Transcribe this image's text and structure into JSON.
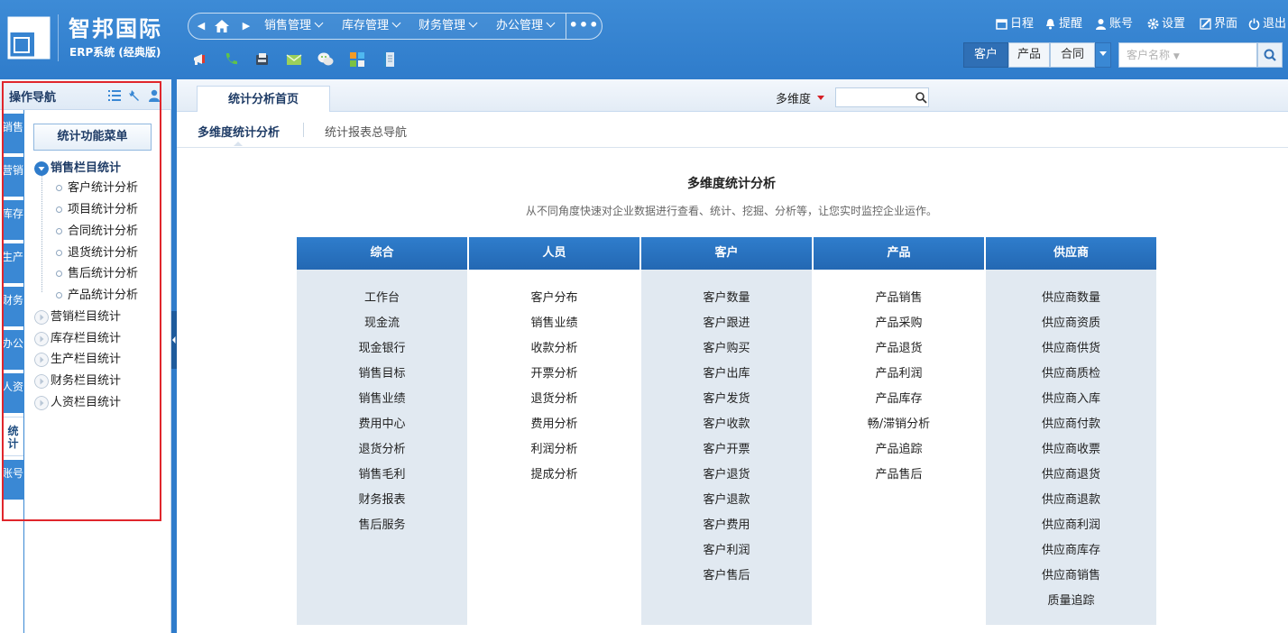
{
  "app": {
    "title": "智邦国际",
    "subtitle": "ERP系统 (经典版)"
  },
  "topnav": {
    "menus": [
      "销售管理",
      "库存管理",
      "财务管理",
      "办公管理"
    ],
    "more": "•••"
  },
  "quicktools": [
    "megaphone-icon",
    "phone-icon",
    "fax-icon",
    "mail-icon",
    "wechat-icon",
    "apps-icon",
    "document-icon"
  ],
  "usertools": {
    "schedule": "日程",
    "reminder": "提醒",
    "account": "账号",
    "settings": "设置",
    "interface": "界面",
    "logout": "退出"
  },
  "search": {
    "segments": [
      "客户",
      "产品",
      "合同"
    ],
    "active_segment": "客户",
    "placeholder": "客户名称"
  },
  "sidebar": {
    "title": "操作导航",
    "vtabs": [
      "销售",
      "营销",
      "库存",
      "生产",
      "财务",
      "办公",
      "人资",
      "统计",
      "账号"
    ],
    "active_vtab": "统计",
    "menu_button": "统计功能菜单",
    "tree": [
      {
        "label": "销售栏目统计",
        "expanded": true,
        "children": [
          "客户统计分析",
          "项目统计分析",
          "合同统计分析",
          "退货统计分析",
          "售后统计分析",
          "产品统计分析"
        ]
      },
      {
        "label": "营销栏目统计",
        "expanded": false
      },
      {
        "label": "库存栏目统计",
        "expanded": false
      },
      {
        "label": "生产栏目统计",
        "expanded": false
      },
      {
        "label": "财务栏目统计",
        "expanded": false
      },
      {
        "label": "人资栏目统计",
        "expanded": false
      }
    ]
  },
  "main": {
    "tab": "统计分析首页",
    "dimension_label": "多维度",
    "subtabs": [
      "多维度统计分析",
      "统计报表总导航"
    ],
    "title": "多维度统计分析",
    "subtitle": "从不同角度快速对企业数据进行查看、统计、挖掘、分析等，让您实时监控企业运作。",
    "columns": [
      {
        "header": "综合",
        "items": [
          "工作台",
          "现金流",
          "现金银行",
          "销售目标",
          "销售业绩",
          "费用中心",
          "退货分析",
          "销售毛利",
          "财务报表",
          "售后服务"
        ]
      },
      {
        "header": "人员",
        "items": [
          "客户分布",
          "销售业绩",
          "收款分析",
          "开票分析",
          "退货分析",
          "费用分析",
          "利润分析",
          "提成分析"
        ]
      },
      {
        "header": "客户",
        "items": [
          "客户数量",
          "客户跟进",
          "客户购买",
          "客户出库",
          "客户发货",
          "客户收款",
          "客户开票",
          "客户退货",
          "客户退款",
          "客户费用",
          "客户利润",
          "客户售后"
        ]
      },
      {
        "header": "产品",
        "items": [
          "产品销售",
          "产品采购",
          "产品退货",
          "产品利润",
          "产品库存",
          "畅/滞销分析",
          "产品追踪",
          "产品售后"
        ]
      },
      {
        "header": "供应商",
        "items": [
          "供应商数量",
          "供应商资质",
          "供应商供货",
          "供应商质检",
          "供应商入库",
          "供应商付款",
          "供应商收票",
          "供应商退货",
          "供应商退款",
          "供应商利润",
          "供应商库存",
          "供应商销售",
          "质量追踪"
        ]
      }
    ]
  },
  "colors": {
    "header_blue": "#2f7ccb",
    "active_segment": "#2f6fb5",
    "column_header": "#2368b3",
    "highlight_border": "#e0262c"
  }
}
